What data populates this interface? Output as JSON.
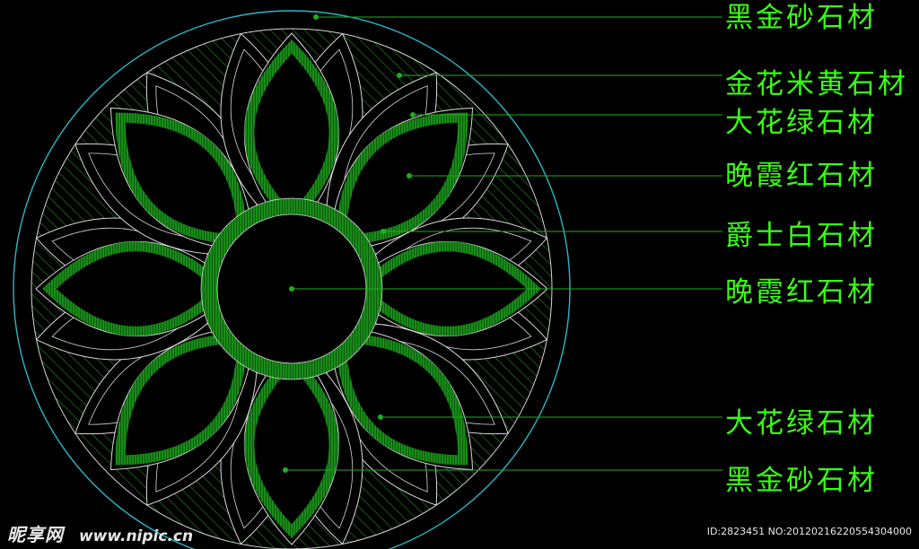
{
  "labels": [
    {
      "id": "label-1",
      "text": "黑金砂石材"
    },
    {
      "id": "label-2",
      "text": "金花米黄石材"
    },
    {
      "id": "label-3",
      "text": "大花绿石材"
    },
    {
      "id": "label-4",
      "text": "晚霞红石材"
    },
    {
      "id": "label-5",
      "text": "爵士白石材"
    },
    {
      "id": "label-6",
      "text": "晚霞红石材"
    },
    {
      "id": "label-7",
      "text": "大花绿石材"
    },
    {
      "id": "label-8",
      "text": "黑金砂石材"
    }
  ],
  "watermark": {
    "brand": "昵享网",
    "url": "www.nipic.cn",
    "id_text": "ID:2823451 NO:20120216220554304000"
  },
  "colors": {
    "background": "#000000",
    "outer_ring": "#2ab7c9",
    "line_white": "#d8d8d8",
    "accent_green": "#1fae1f",
    "label_green": "#39ff14",
    "hatch": "#2a8a2a"
  }
}
